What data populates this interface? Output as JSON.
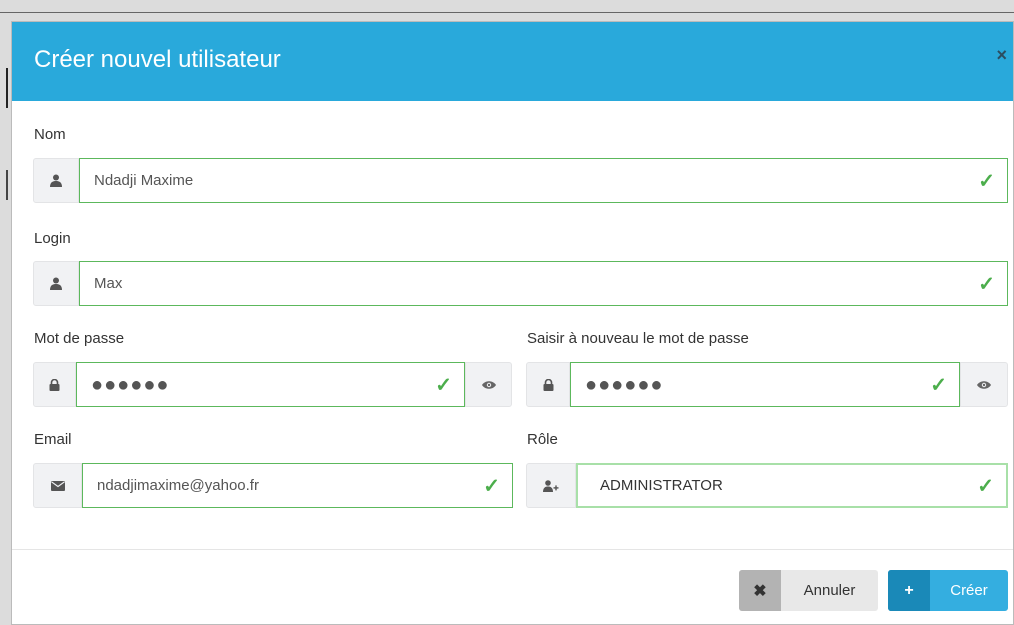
{
  "modal": {
    "title": "Créer nouvel utilisateur",
    "close_label": "×"
  },
  "form": {
    "nom": {
      "label": "Nom",
      "value": "Ndadji Maxime"
    },
    "login": {
      "label": "Login",
      "value": "Max"
    },
    "password": {
      "label": "Mot de passe",
      "value": "●●●●●●"
    },
    "password_confirm": {
      "label": "Saisir à nouveau le mot de passe",
      "value": "●●●●●●"
    },
    "email": {
      "label": "Email",
      "value": "ndadjimaxime@yahoo.fr"
    },
    "role": {
      "label": "Rôle",
      "value": "ADMINISTRATOR"
    },
    "check_mark": "✓"
  },
  "buttons": {
    "cancel": {
      "icon": "✖",
      "label": "Annuler"
    },
    "create": {
      "icon": "+",
      "label": "Créer"
    }
  },
  "colors": {
    "header": "#29a9db",
    "valid": "#5cb85c",
    "create_button": "#34aee0",
    "cancel_button": "#e8e8e8"
  },
  "icons": [
    "user-icon",
    "lock-icon",
    "eye-icon",
    "envelope-icon",
    "user-plus-icon",
    "close-icon"
  ]
}
